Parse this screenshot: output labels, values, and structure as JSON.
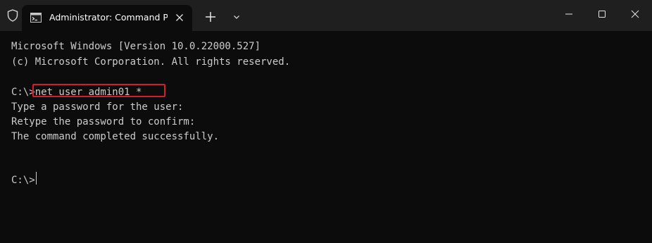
{
  "window": {
    "tab_title": "Administrator: Command Prompt",
    "tab_icon": "cmd-icon",
    "titlebar_icon": "shield-icon",
    "new_tab_icon": "plus-icon",
    "dropdown_icon": "chevron-down-icon",
    "controls": [
      "minimize-icon",
      "maximize-icon",
      "close-icon"
    ]
  },
  "console": {
    "lines": [
      "Microsoft Windows [Version 10.0.22000.527]",
      "(c) Microsoft Corporation. All rights reserved.",
      "",
      "C:\\>net user admin01 *",
      "Type a password for the user:",
      "Retype the password to confirm:",
      "The command completed successfully.",
      "",
      "",
      "C:\\>"
    ]
  },
  "colors": {
    "titlebar": "#1f1f1f",
    "console_bg": "#0c0c0c",
    "text": "#cccccc",
    "highlight": "#d21f2b"
  }
}
